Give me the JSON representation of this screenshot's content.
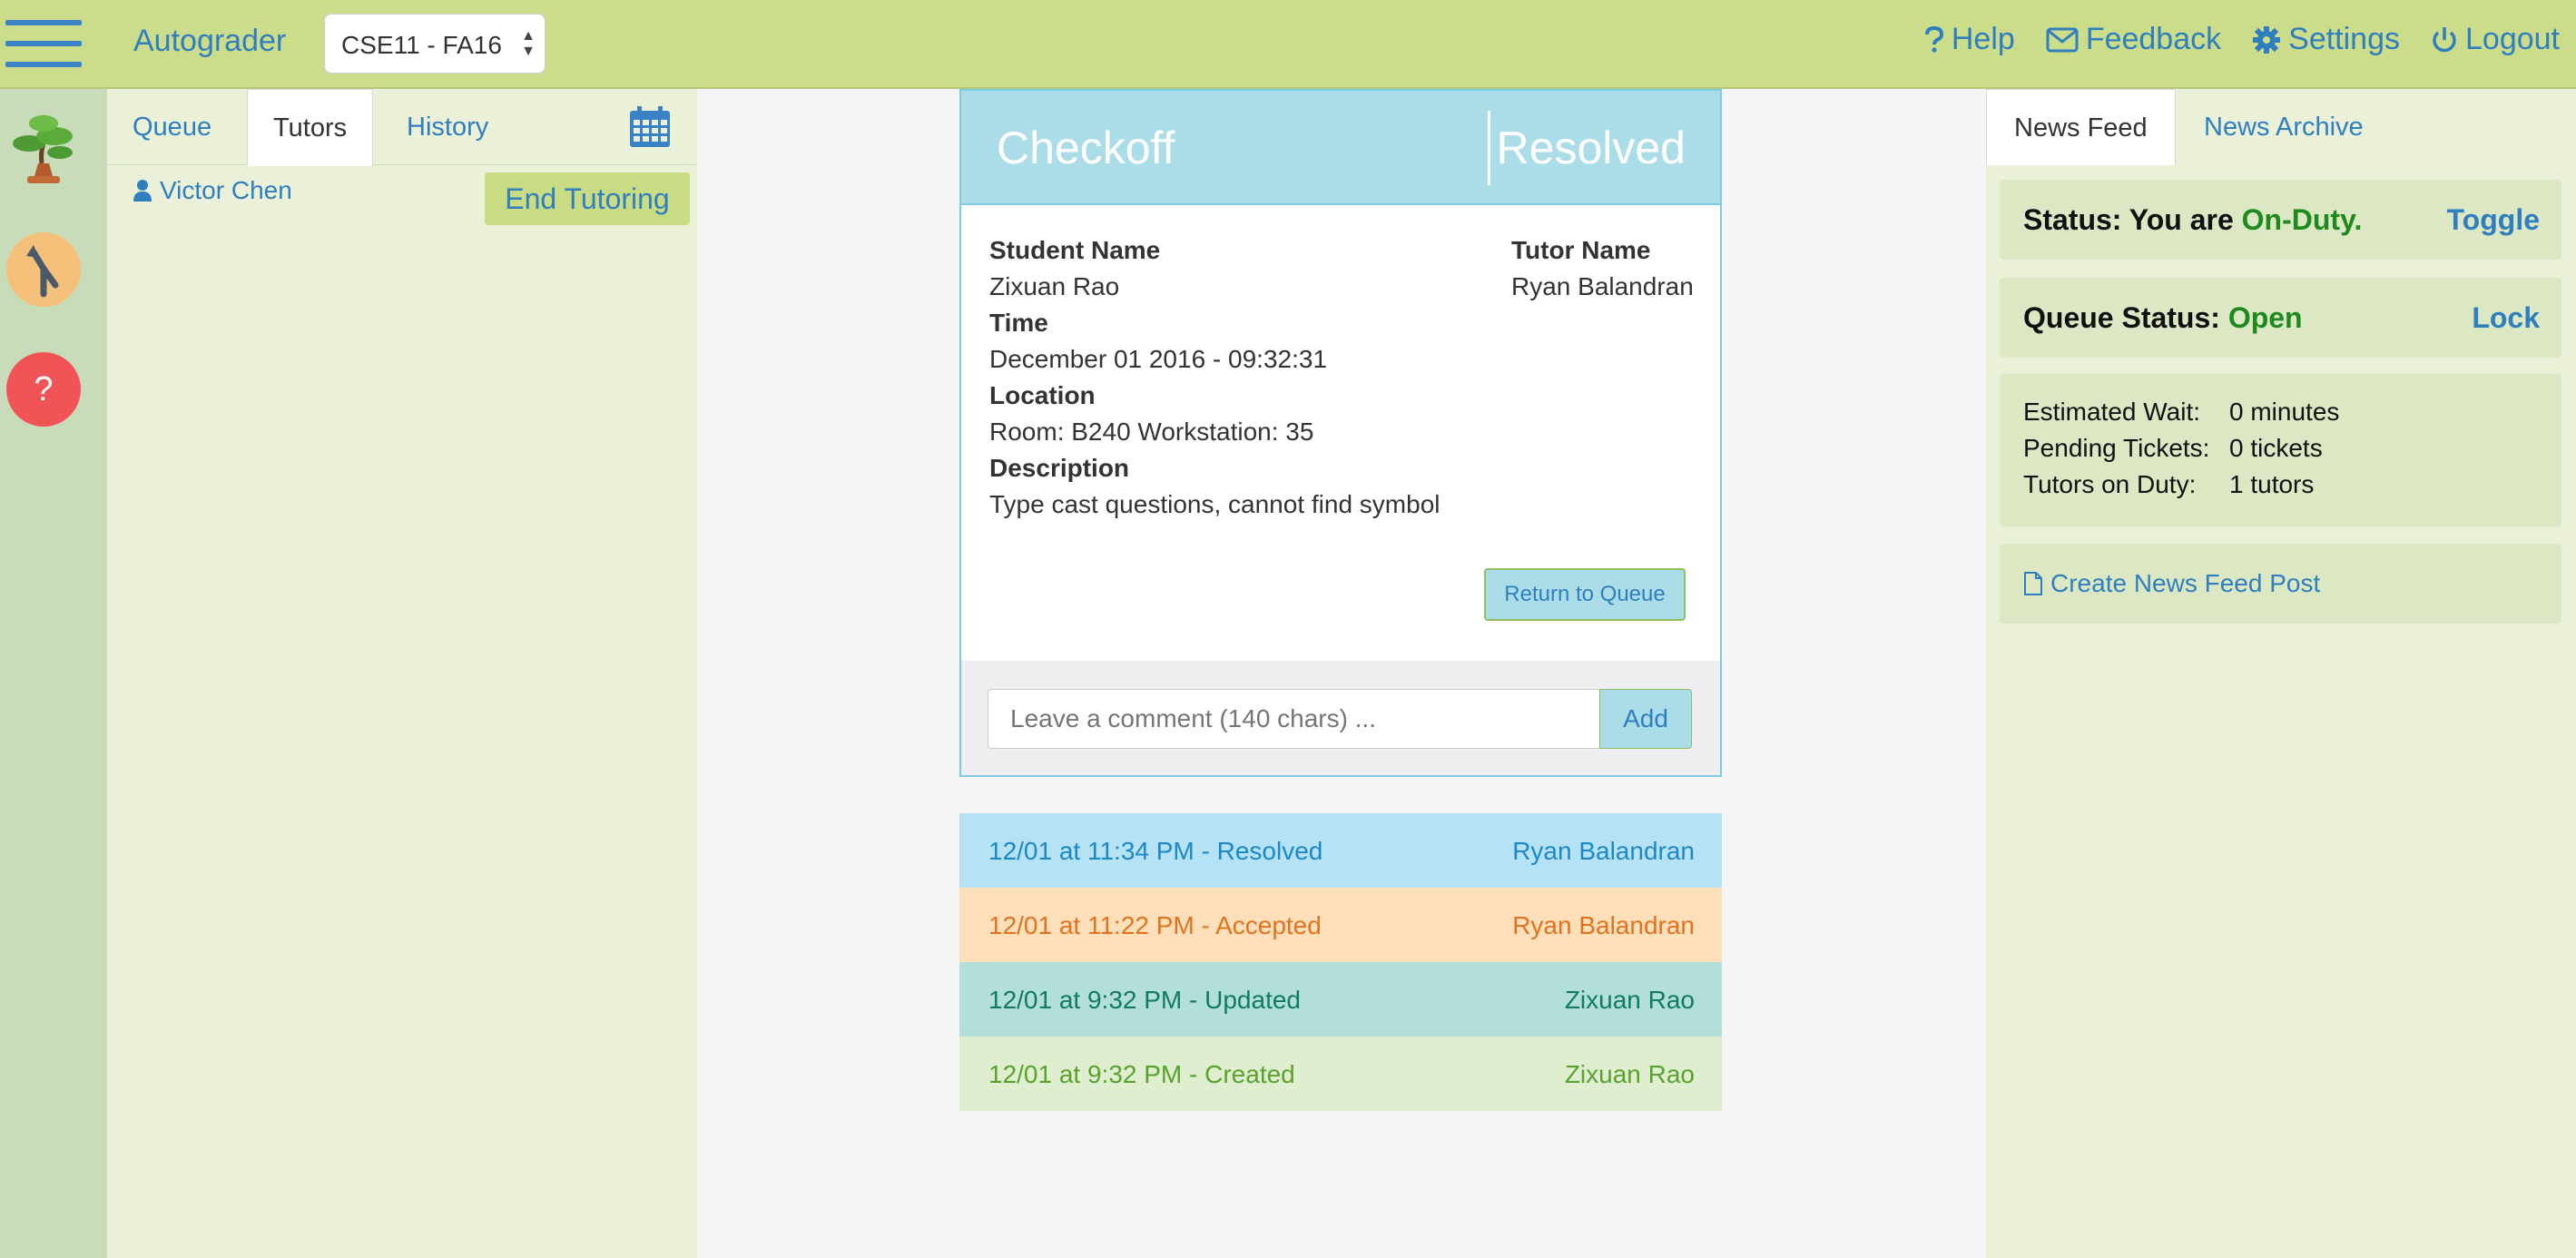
{
  "header": {
    "brand": "Autograder",
    "course": "CSE11 - FA16",
    "nav": {
      "help": "Help",
      "feedback": "Feedback",
      "settings": "Settings",
      "logout": "Logout"
    }
  },
  "rail": {
    "icons": [
      "tree-icon",
      "merge-icon",
      "help-icon"
    ],
    "help_glyph": "?"
  },
  "left_panel": {
    "tabs": [
      "Queue",
      "Tutors",
      "History"
    ],
    "active_tab": "Tutors",
    "tutor_name": "Victor Chen",
    "end_button": "End Tutoring"
  },
  "ticket": {
    "title": "Checkoff",
    "status": "Resolved",
    "student_label": "Student Name",
    "student": "Zixuan Rao",
    "tutor_label": "Tutor Name",
    "tutor": "Ryan Balandran",
    "time_label": "Time",
    "time": "December 01 2016 - 09:32:31",
    "location_label": "Location",
    "location": "Room: B240 Workstation: 35",
    "description_label": "Description",
    "description": "Type cast questions, cannot find symbol",
    "return_button": "Return to Queue",
    "comment_placeholder": "Leave a comment (140 chars) ...",
    "add_button": "Add"
  },
  "history": [
    {
      "event": "12/01 at 11:34 PM - Resolved",
      "person": "Ryan Balandran",
      "kind": "resolved"
    },
    {
      "event": "12/01 at 11:22 PM - Accepted",
      "person": "Ryan Balandran",
      "kind": "accepted"
    },
    {
      "event": "12/01 at 9:32 PM - Updated",
      "person": "Zixuan Rao",
      "kind": "updated"
    },
    {
      "event": "12/01 at 9:32 PM - Created",
      "person": "Zixuan Rao",
      "kind": "created"
    }
  ],
  "right_panel": {
    "tabs": [
      "News Feed",
      "News Archive"
    ],
    "active_tab": "News Feed",
    "duty_prefix": "Status: You are ",
    "duty_value": "On-Duty.",
    "toggle": "Toggle",
    "queue_prefix": "Queue Status: ",
    "queue_value": "Open",
    "lock": "Lock",
    "stats": [
      {
        "label": "Estimated Wait:",
        "value": "0 minutes"
      },
      {
        "label": "Pending Tickets:",
        "value": "0 tickets"
      },
      {
        "label": "Tutors on Duty:",
        "value": "1 tutors"
      }
    ],
    "create_post": "Create News Feed Post"
  },
  "colors": {
    "topbar": "#cbdc8b",
    "panel": "#eaf1d8",
    "link": "#2f7fbf",
    "ticket_header": "#abdde9",
    "on_duty_green": "#1e8a1e"
  }
}
